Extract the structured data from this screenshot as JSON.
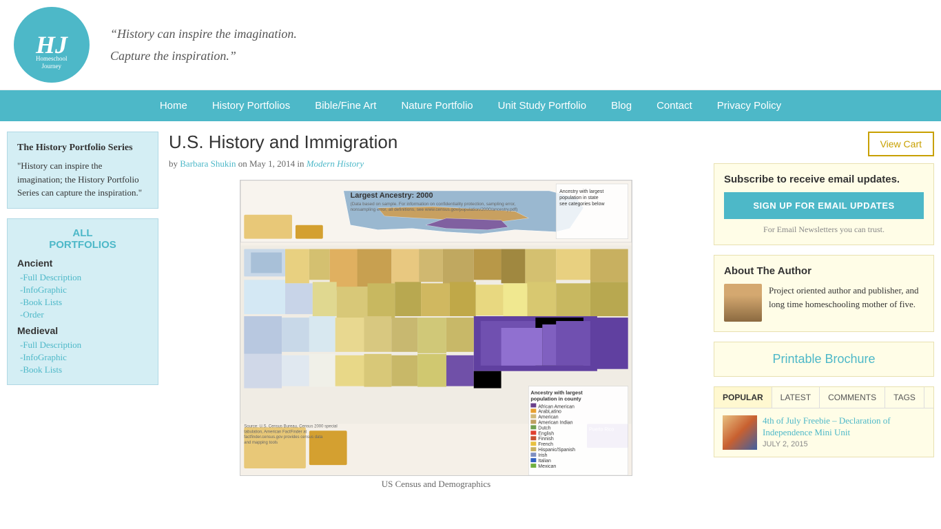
{
  "site": {
    "logo_letters": "HJ",
    "logo_sub": "Homeschool\nJourney",
    "tagline_line1": "“History can inspire the imagination.",
    "tagline_line2": "Capture the inspiration.”"
  },
  "nav": {
    "items": [
      {
        "label": "Home",
        "href": "#"
      },
      {
        "label": "History Portfolios",
        "href": "#"
      },
      {
        "label": "Bible/Fine Art",
        "href": "#"
      },
      {
        "label": "Nature Portfolio",
        "href": "#"
      },
      {
        "label": "Unit Study Portfolio",
        "href": "#"
      },
      {
        "label": "Blog",
        "href": "#"
      },
      {
        "label": "Contact",
        "href": "#"
      },
      {
        "label": "Privacy Policy",
        "href": "#"
      }
    ]
  },
  "sidebar": {
    "series_title": "The History Portfolio Series",
    "series_desc": "\"History can inspire the imagination; the History Portfolio Series can capture the inspiration.\"",
    "all_portfolios_label": "ALL\nPORTFOLIOS",
    "sections": [
      {
        "heading": "Ancient",
        "links": [
          "-Full Description",
          "-InfoGraphic",
          "-Book Lists",
          "-Order"
        ]
      },
      {
        "heading": "Medieval",
        "links": [
          "-Full Description",
          "-InfoGraphic",
          "-Book Lists"
        ]
      }
    ]
  },
  "post": {
    "title": "U.S. History and Immigration",
    "author": "Barbara Shukin",
    "date": "May 1, 2014",
    "category": "Modern History",
    "image_caption": "US Census and Demographics"
  },
  "right_sidebar": {
    "view_cart_label": "View Cart",
    "email_box_title": "Subscribe to receive email updates.",
    "email_signup_label": "SIGN UP FOR EMAIL UPDATES",
    "email_trust_text": "For Email Newsletters you can trust.",
    "author_title": "About The Author",
    "author_desc": "Project oriented author and publisher, and long time homeschooling mother of five.",
    "printable_title": "Printable Brochure",
    "tabs": [
      "POPULAR",
      "LATEST",
      "COMMENTS",
      "TAGS"
    ],
    "active_tab": "POPULAR",
    "popular_post_title": "4th of July Freebie – Declaration of Independence Mini Unit",
    "popular_post_date": "JULY 2, 2015"
  }
}
